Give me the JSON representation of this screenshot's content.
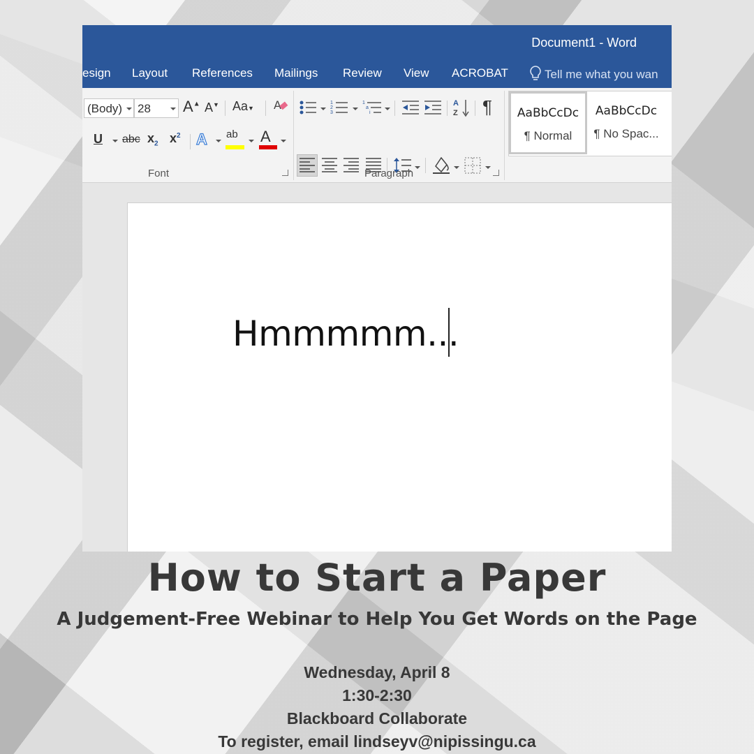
{
  "window": {
    "title": "Document1 - Word",
    "accent": "#2b579a"
  },
  "tabs": [
    "esign",
    "Layout",
    "References",
    "Mailings",
    "Review",
    "View",
    "ACROBAT"
  ],
  "tell_me": "Tell me what you wan",
  "font_group": {
    "label": "Font",
    "font_name": "(Body)",
    "font_size": "28",
    "grow_icon": "grow-font-icon",
    "shrink_icon": "shrink-font-icon",
    "case_label": "Aa",
    "underline": "U",
    "strike": "abc",
    "subscript": "x",
    "subscript_mark": "2",
    "superscript": "x",
    "superscript_mark": "2",
    "effects": "A",
    "highlight": "ab",
    "font_color": "A",
    "highlight_color": "#ffff00",
    "font_color_bar": "#e00000"
  },
  "paragraph_group": {
    "label": "Paragraph",
    "pilcrow": "¶"
  },
  "styles": [
    {
      "sample": "AaBbCcDc",
      "name": "¶ Normal"
    },
    {
      "sample": "AaBbCcDc",
      "name": "¶ No Spac..."
    }
  ],
  "document": {
    "text": "Hmmmmm..."
  },
  "poster": {
    "headline": "How to Start a Paper",
    "subheadline": "A Judgement-Free Webinar to Help You Get Words on the Page",
    "date": "Wednesday, April 8",
    "time": "1:30-2:30",
    "platform": "Blackboard Collaborate",
    "register": "To register, email lindseyv@nipissingu.ca"
  }
}
